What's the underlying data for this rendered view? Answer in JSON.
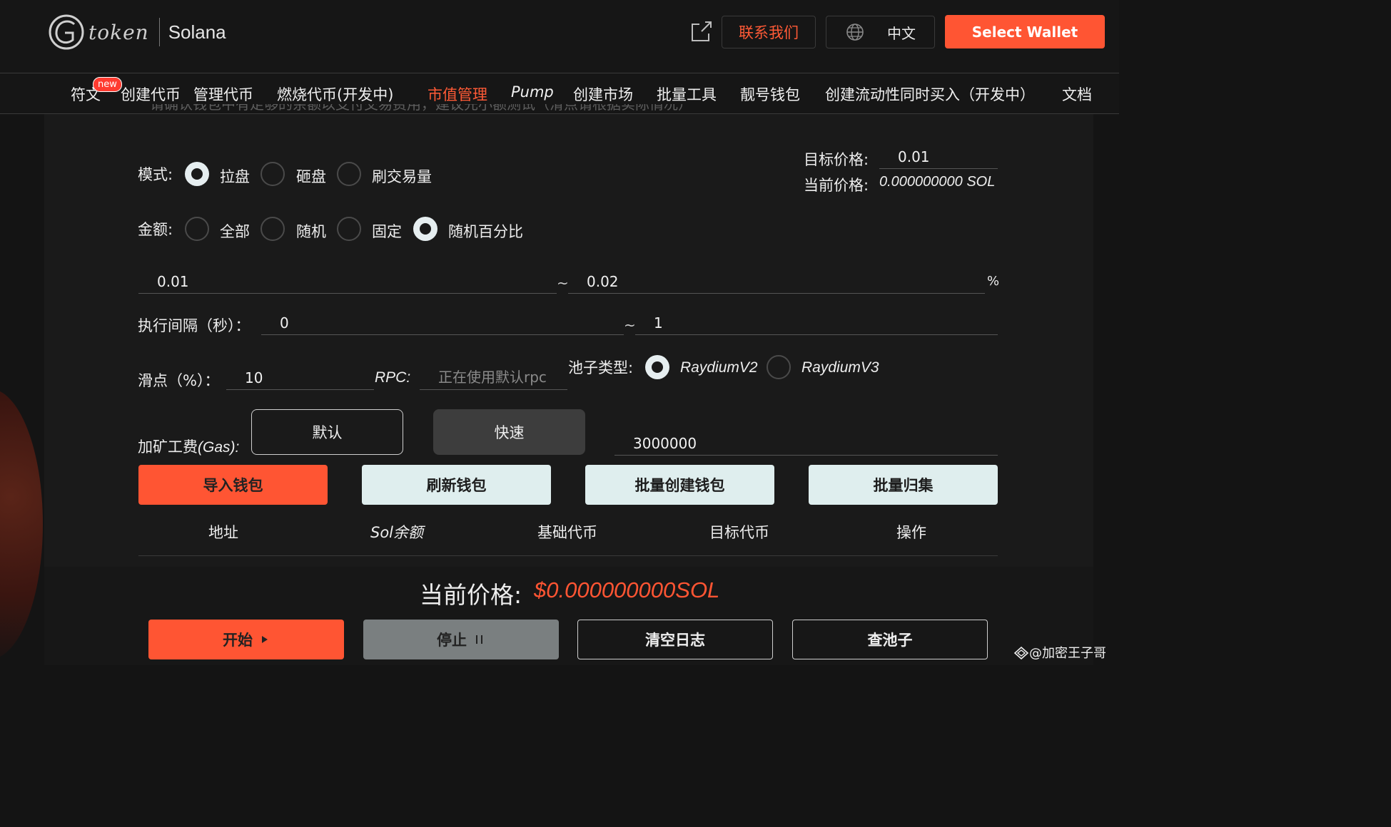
{
  "header": {
    "logo_text": "token",
    "chain": "Solana",
    "contact_label": "联系我们",
    "lang_label": "中文",
    "wallet_label": "Select Wallet"
  },
  "nav": {
    "badge": "new",
    "items": [
      "符文",
      "创建代币",
      "管理代币",
      "燃烧代币(开发中)",
      "市值管理",
      "Pump",
      "创建市场",
      "批量工具",
      "靓号钱包",
      "创建流动性同时买入（开发中）",
      "文档"
    ],
    "active": "市值管理"
  },
  "form": {
    "faded_notice": "请确认钱包中有足够的余额以支付交易费用，建议先小额测试（滑点请根据实际情况）",
    "mode_label": "模式:",
    "mode_options": [
      "拉盘",
      "砸盘",
      "刷交易量"
    ],
    "mode_selected": "拉盘",
    "target_price_label": "目标价格:",
    "target_price_value": "0.01",
    "current_price_label": "当前价格:",
    "current_price_value": "0.000000000 SOL",
    "amount_label": "金额:",
    "amount_options": [
      "全部",
      "随机",
      "固定",
      "随机百分比"
    ],
    "amount_selected": "随机百分比",
    "range_min": "0.01",
    "range_max": "0.02",
    "range_tilde": "~",
    "range_unit": "%",
    "interval_label": "执行间隔（秒）：",
    "interval_min": "0",
    "interval_max": "1",
    "slippage_label": "滑点（%）：",
    "slippage_value": "10",
    "rpc_label": "RPC:",
    "rpc_placeholder": "正在使用默认rpc",
    "pool_type_label": "池子类型:",
    "pool_options": [
      "RaydiumV2",
      "RaydiumV3"
    ],
    "pool_selected": "RaydiumV2",
    "gas_label_cn": "加矿工费",
    "gas_label_en": "(Gas):",
    "gas_default": "默认",
    "gas_fast": "快速",
    "gas_value": "3000000"
  },
  "actions": [
    "导入钱包",
    "刷新钱包",
    "批量创建钱包",
    "批量归集"
  ],
  "table": {
    "headers": [
      "地址",
      "Sol余额",
      "基础代币",
      "目标代币",
      "操作"
    ]
  },
  "status": {
    "title": "当前价格:",
    "value": "$0.000000000SOL"
  },
  "controls": {
    "start": "开始",
    "stop": "停止",
    "clear_log": "清空日志",
    "check_pool": "查池子"
  },
  "watermark": "@加密王子哥",
  "colors": {
    "accent": "#ff5533",
    "background": "#141414",
    "light_button": "#dfeeee"
  }
}
